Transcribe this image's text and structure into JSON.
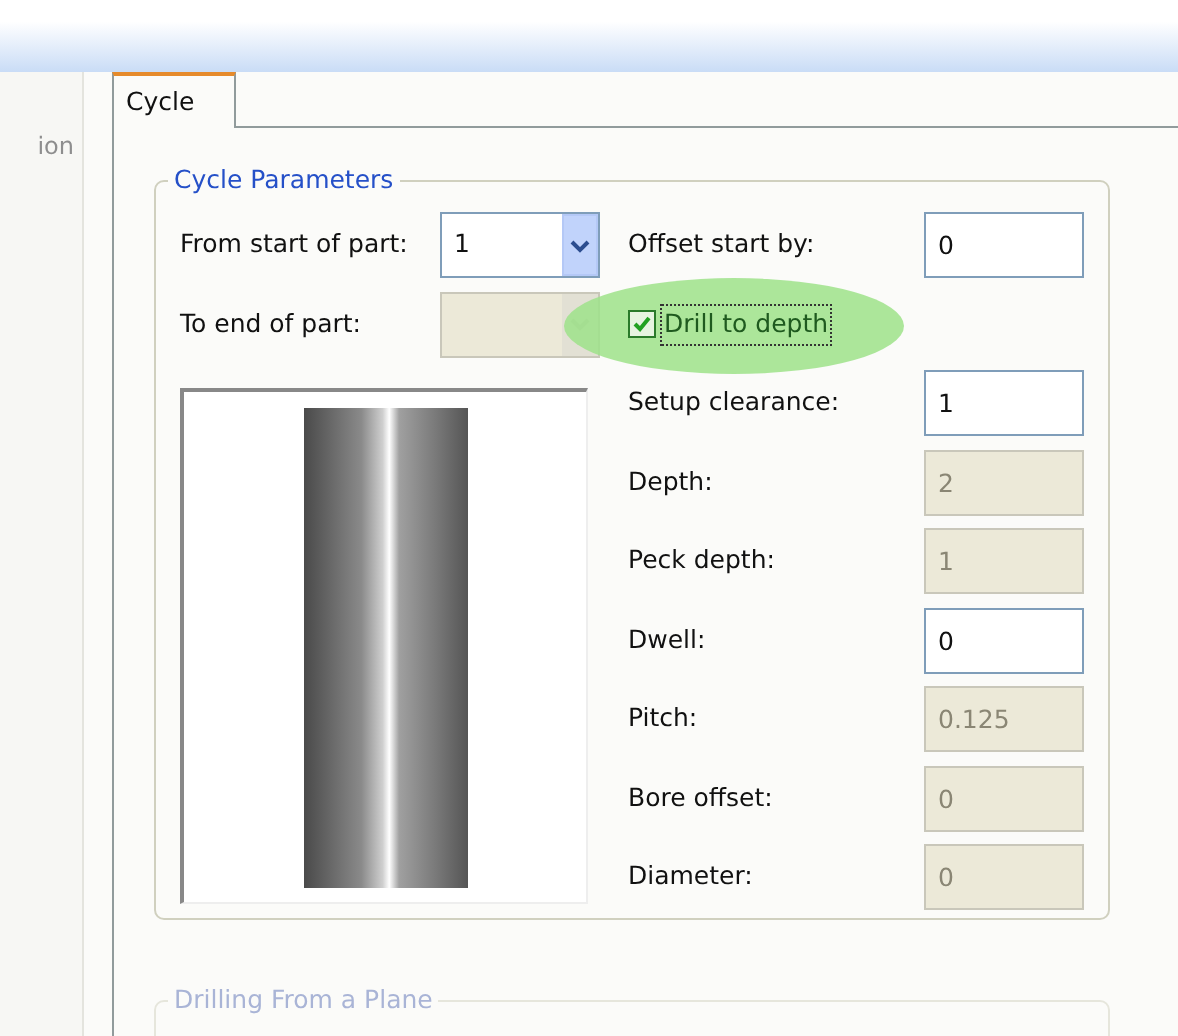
{
  "side_panel": {
    "text": "ion"
  },
  "tabs": [
    {
      "label": "Cycle",
      "selected": true
    }
  ],
  "cycle_parameters": {
    "title": "Cycle Parameters",
    "combos": [
      {
        "label": "From start of part:",
        "value": "1",
        "disabled": false
      },
      {
        "label": "To end of part:",
        "disabled": true
      }
    ],
    "checkbox": {
      "label": "Drill to depth",
      "checked": true,
      "highlighted": true
    },
    "fields": [
      {
        "label": "Offset start by:",
        "value": "0",
        "disabled": false
      },
      {
        "label": "Setup clearance:",
        "value": "1",
        "disabled": false
      },
      {
        "label": "Depth:",
        "value": "2",
        "disabled": true
      },
      {
        "label": "Peck depth:",
        "value": "1",
        "disabled": true
      },
      {
        "label": "Dwell:",
        "value": "0",
        "disabled": false
      },
      {
        "label": "Pitch:",
        "value": "0.125",
        "disabled": true
      },
      {
        "label": "Bore offset:",
        "value": "0",
        "disabled": true
      },
      {
        "label": "Diameter:",
        "value": "0",
        "disabled": true
      }
    ]
  },
  "drilling_from_plane": {
    "title": "Drilling From a Plane"
  }
}
